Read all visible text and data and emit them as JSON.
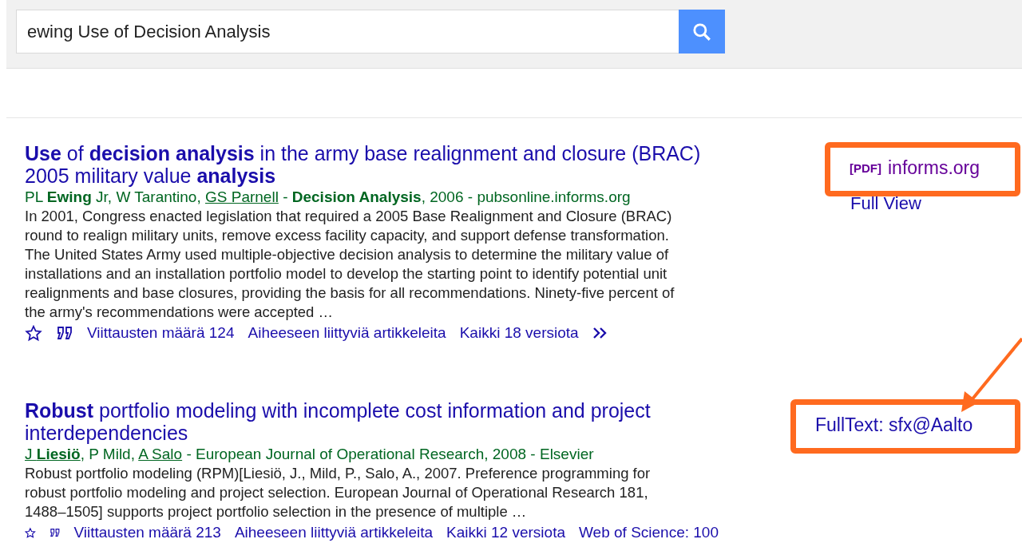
{
  "search": {
    "value": "ewing Use of Decision Analysis"
  },
  "results": [
    {
      "title": "**Use** of **decision analysis** in the army base realignment and closure (BRAC) 2005 military value **analysis**",
      "source": [
        {
          "kind": "text",
          "text": "PL **Ewing** Jr, W Tarantino, "
        },
        {
          "kind": "link",
          "text": "GS Parnell"
        },
        {
          "kind": "text",
          "text": " - **Decision Analysis**, 2006 - pubsonline.informs.org"
        }
      ],
      "snippet": "In 2001, Congress enacted legislation that required a 2005 Base Realignment and Closure (BRAC) round to realign military units, remove excess facility capacity, and support defense transformation. The United States Army used multiple-objective decision analysis to determine the military value of installations and an installation portfolio model to develop the starting point to identify potential unit realignments and base closures, providing the basis for all recommendations. Ninety-five percent of the army's recommendations were accepted …",
      "actions": [
        "Viittausten määrä 124",
        "Aiheeseen liittyviä artikkeleita",
        "Kaikki 18 versiota"
      ],
      "more": true,
      "side": {
        "highlighted": true,
        "pdf_tag": "[PDF]",
        "link": "informs.org",
        "below": "Full View"
      }
    },
    {
      "title": "**Robust** portfolio modeling with incomplete cost information and project interdependencies",
      "source": [
        {
          "kind": "link",
          "text": "J **Liesiö**"
        },
        {
          "kind": "text",
          "text": ", P Mild, "
        },
        {
          "kind": "link",
          "text": "A Salo"
        },
        {
          "kind": "text",
          "text": " - European Journal of Operational Research, 2008 - Elsevier"
        }
      ],
      "snippet": "Robust portfolio modeling (RPM)[Liesiö, J., Mild, P., Salo, A., 2007. Preference programming for robust portfolio modeling and project selection. European Journal of Operational Research 181, 1488–1505] supports project portfolio selection in the presence of multiple …",
      "actions": [
        "Viittausten määrä 213",
        "Aiheeseen liittyviä artikkeleita",
        "Kaikki 12 versiota",
        "Web of Science: 100"
      ],
      "more": false,
      "side": {
        "highlighted": true,
        "link": "FullText: sfx@Aalto",
        "arrow": true
      }
    }
  ]
}
